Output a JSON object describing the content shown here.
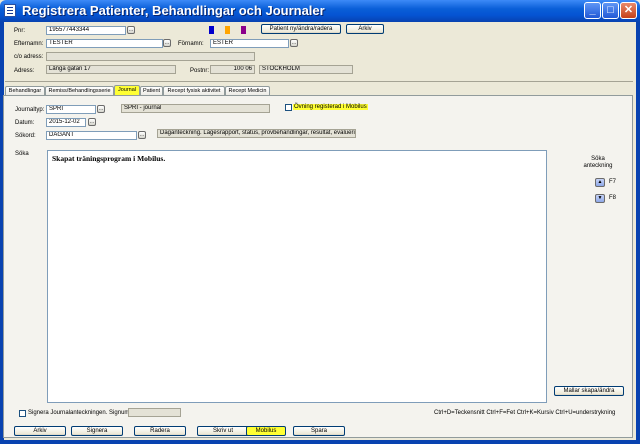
{
  "window": {
    "title": "Registrera Patienter, Behandlingar och Journaler",
    "minimize": "_",
    "maximize": "□",
    "close": "✕"
  },
  "patient": {
    "pnr_label": "Pnr:",
    "pnr_value": "195577443344",
    "efternamn_label": "Efternamn:",
    "efternamn_value": "TESTER",
    "fornamn_label": "Förnamn:",
    "fornamn_value": "ESTER",
    "co_label": "c/o adress:",
    "co_value": "",
    "adress_label": "Adress:",
    "adress_value": "Långa gatan 17",
    "postnr_label": "Postnr:",
    "postnr_value": "100 06",
    "ort_value": "STOCKHOLM",
    "new_button": "Patient ny/ändra/radera",
    "archive_button": "Arkiv",
    "swatch_colors": [
      "#0000cc",
      "#ffa500",
      "#8b008b"
    ]
  },
  "tabs": [
    "Behandlingar",
    "Remiss/Behandlingsserie",
    "Journal",
    "Patient",
    "Recept fysisk aktivitet",
    "Recept Medicin"
  ],
  "active_tab": "Journal",
  "journal": {
    "typ_label": "Journaltyp:",
    "typ_value": "SPRI",
    "typ_desc": "SPRI - journal",
    "datum_label": "Datum:",
    "datum_value": "2015-12-02",
    "sokord_label": "Sökord:",
    "sokord_value": "DAGANT",
    "sokord_desc": "Daganteckning. Lägesrapport, status, provbehandlingar, resultat, evaluering",
    "ovning_label": "Övning registerad i Mobilus",
    "soka_label": "Söka",
    "text": "Skapat träningsprogram i Mobilus.",
    "search_title": "Söka anteckning",
    "f7": "F7",
    "f8": "F8",
    "mallar_button": "Mallar skapa/ändra",
    "signera_label": "Signera Journalanteckningen. Signum:",
    "signum_value": "",
    "shortcuts": "Ctrl+D=Teckensnitt Ctrl+F=Fet Ctrl+K=Kursiv Ctrl+U=understrykning"
  },
  "bottom_buttons": {
    "arkiv": "Arkiv",
    "signera": "Signera",
    "radera": "Radera",
    "skriv_ut": "Skriv ut",
    "mobilus": "Mobilus",
    "spara": "Spara"
  }
}
